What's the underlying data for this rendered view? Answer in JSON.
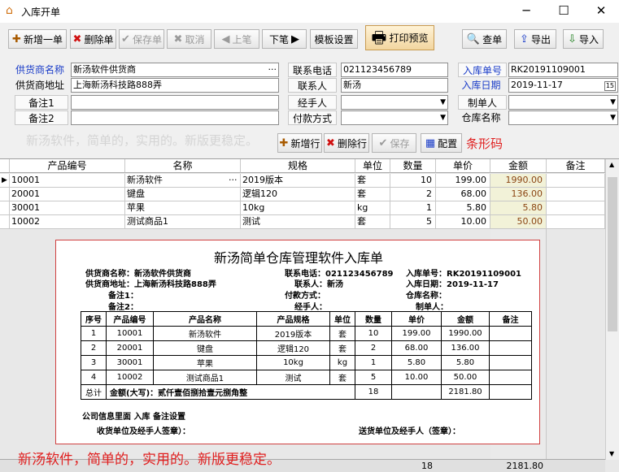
{
  "window": {
    "title": "入库开单",
    "minimize_glyph": "─",
    "maximize_glyph": "☐",
    "close_glyph": "✕"
  },
  "toolbar": {
    "add_label": "新增一单",
    "delete_label": "删除单",
    "save_label": "保存单",
    "cancel_label": "取消",
    "prev_label": "上笔",
    "next_label": "下笔",
    "template_label": "模板设置",
    "print_label": "打印预览",
    "search_label": "查单",
    "export_label": "导出",
    "import_label": "导入"
  },
  "form": {
    "supplier_name_label": "供货商名称",
    "supplier_name_value": "新汤软件供货商",
    "supplier_addr_label": "供货商地址",
    "supplier_addr_value": "上海新汤科技路888弄",
    "note1_label": "备注1",
    "note2_label": "备注2",
    "phone_label": "联系电话",
    "phone_value": "021123456789",
    "contact_label": "联系人",
    "contact_value": "新汤",
    "handler_label": "经手人",
    "payment_label": "付款方式",
    "order_no_label": "入库单号",
    "order_no_value": "RK20191109001",
    "date_label": "入库日期",
    "date_value": "2019-11-17",
    "maker_label": "制单人",
    "warehouse_label": "仓库名称",
    "ellipsis": "···",
    "calendar": "15"
  },
  "watermark_text": "新汤软件，简单的，实用的。新版更稳定。",
  "row_actions": {
    "add_row_label": "新增行",
    "delete_row_label": "删除行",
    "save_label": "保存",
    "config_label": "配置",
    "barcode_label": "条形码"
  },
  "grid": {
    "columns": [
      "产品编号",
      "名称",
      "规格",
      "单位",
      "数量",
      "单价",
      "金额",
      "备注"
    ],
    "rows": [
      {
        "code": "10001",
        "name": "新汤软件",
        "spec": "2019版本",
        "unit": "套",
        "qty": "10",
        "price": "199.00",
        "amount": "1990.00",
        "note": ""
      },
      {
        "code": "20001",
        "name": "键盘",
        "spec": "逻辑120",
        "unit": "套",
        "qty": "2",
        "price": "68.00",
        "amount": "136.00",
        "note": ""
      },
      {
        "code": "30001",
        "name": "苹果",
        "spec": "10kg",
        "unit": "kg",
        "qty": "1",
        "price": "5.80",
        "amount": "5.80",
        "note": ""
      },
      {
        "code": "10002",
        "name": "测试商品1",
        "spec": "测试",
        "unit": "套",
        "qty": "5",
        "price": "10.00",
        "amount": "50.00",
        "note": ""
      }
    ],
    "total_qty": "18",
    "total_amount": "2181.80",
    "row_pointer": "▶"
  },
  "preview": {
    "title": "新汤简单仓库管理软件入库单",
    "supplier_name": "供货商名称：新汤软件供货商",
    "supplier_addr": "供货商地址：上海新汤科技路888弄",
    "note1": "备注1：",
    "note2": "备注2：",
    "phone": "联系电话：021123456789",
    "contact": "联系人：新汤",
    "payment": "付款方式：",
    "handler": "经手人：",
    "order_no": "入库单号：RK20191109001",
    "date": "入库日期：2019-11-17",
    "warehouse": "仓库名称：",
    "maker": "制单人：",
    "columns": [
      "序号",
      "产品编号",
      "产品名称",
      "产品规格",
      "单位",
      "数量",
      "单价",
      "金额",
      "备注"
    ],
    "rows": [
      {
        "idx": "1",
        "code": "10001",
        "name": "新汤软件",
        "spec": "2019版本",
        "unit": "套",
        "qty": "10",
        "price": "199.00",
        "amount": "1990.00"
      },
      {
        "idx": "2",
        "code": "20001",
        "name": "键盘",
        "spec": "逻辑120",
        "unit": "套",
        "qty": "2",
        "price": "68.00",
        "amount": "136.00"
      },
      {
        "idx": "3",
        "code": "30001",
        "name": "苹果",
        "spec": "10kg",
        "unit": "kg",
        "qty": "1",
        "price": "5.80",
        "amount": "5.80"
      },
      {
        "idx": "4",
        "code": "10002",
        "name": "测试商品1",
        "spec": "测试",
        "unit": "套",
        "qty": "5",
        "price": "10.00",
        "amount": "50.00"
      }
    ],
    "total_label": "总计",
    "total_words": "金额(大写)：贰仟壹佰捌拾壹元捌角整",
    "total_qty": "18",
    "total_amount": "2181.80",
    "footer_company": "公司信息里面 入库  备注设置",
    "receiver_sign": "收货单位及经手人签章）：",
    "sender_sign": "送货单位及经手人（签章）："
  },
  "bottom_watermark": "新汤软件，简单的，实用的。新版更稳定。",
  "colors": {
    "accent_blue": "#1a3cc8",
    "barcode_red": "#e02020",
    "amount_brown": "#8b4513"
  }
}
